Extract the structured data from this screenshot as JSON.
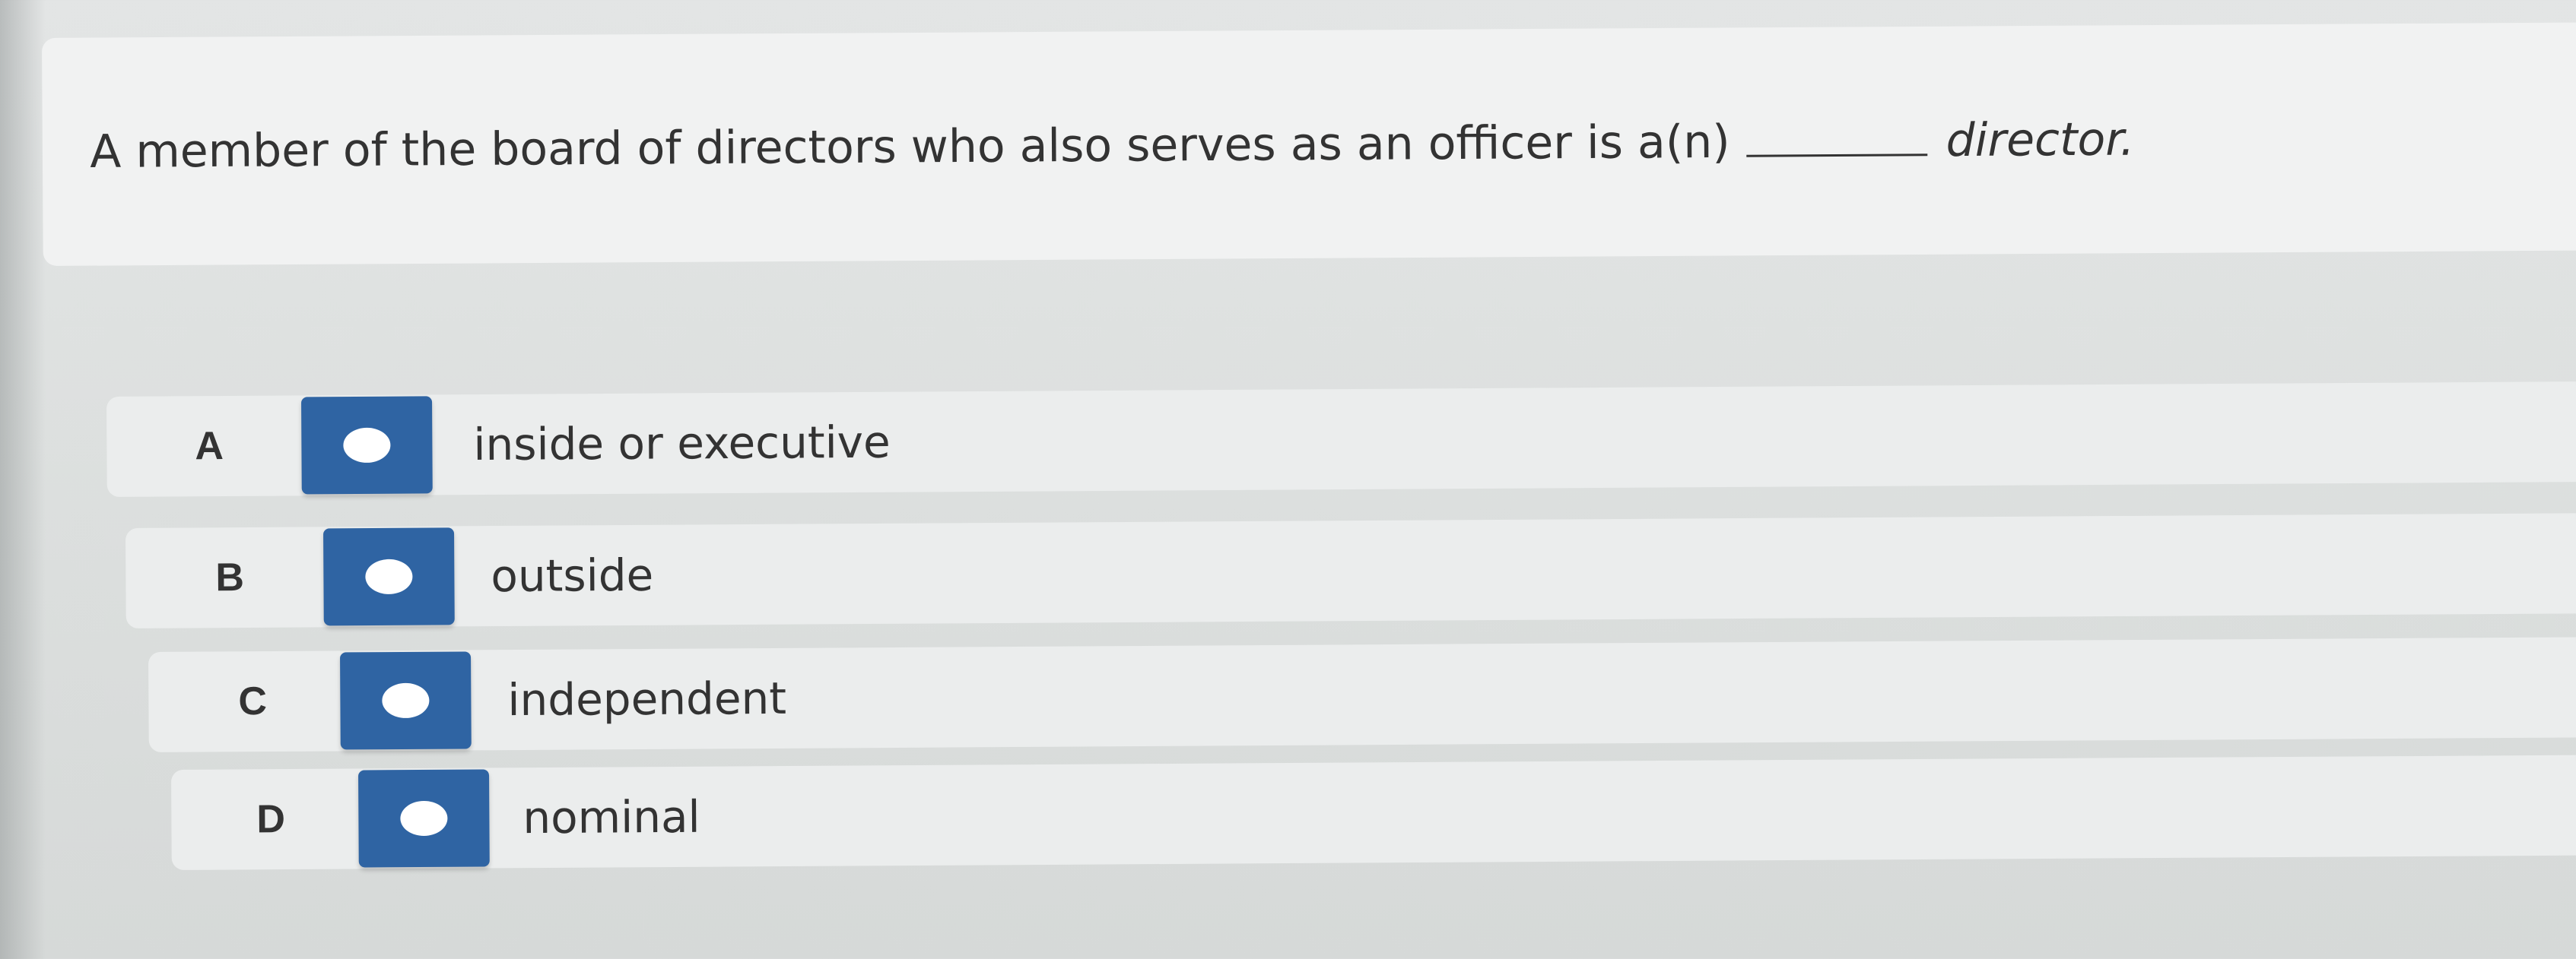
{
  "question": {
    "before_blank": "A member of the board of directors who also serves as an officer is a(n)",
    "after_blank": "director."
  },
  "options": [
    {
      "letter": "A",
      "text": "inside or executive"
    },
    {
      "letter": "B",
      "text": "outside"
    },
    {
      "letter": "C",
      "text": "independent"
    },
    {
      "letter": "D",
      "text": "nominal"
    }
  ],
  "colors": {
    "radio_box": "#2f64a3",
    "text": "#333333"
  },
  "icons": {
    "radio": "radio-button-icon"
  }
}
